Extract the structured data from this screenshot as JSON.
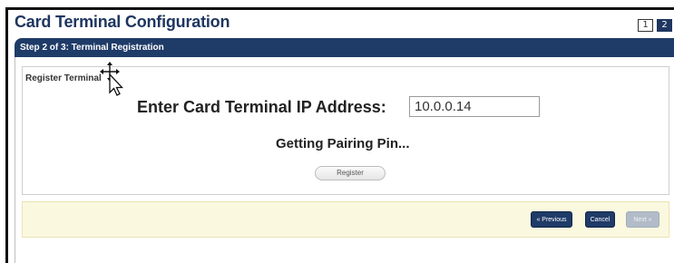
{
  "window": {
    "title": "Card Terminal Configuration",
    "pages": [
      "1",
      "2"
    ],
    "active_page": "2"
  },
  "step": {
    "label": "Step 2 of 3: Terminal Registration"
  },
  "section": {
    "label": "Register Terminal"
  },
  "form": {
    "ip_label": "Enter Card Terminal IP Address:",
    "ip_value": "10.0.0.14",
    "status": "Getting Pairing Pin...",
    "register_label": "Register"
  },
  "nav": {
    "previous_label": "« Previous",
    "cancel_label": "Cancel",
    "next_label": "Next »"
  },
  "colors": {
    "header_blue": "#1f3b68",
    "footer_bg": "#fbf8e0",
    "disabled_button": "#b2bcc8"
  },
  "icons": {
    "cursor": "move-pointer-icon"
  }
}
